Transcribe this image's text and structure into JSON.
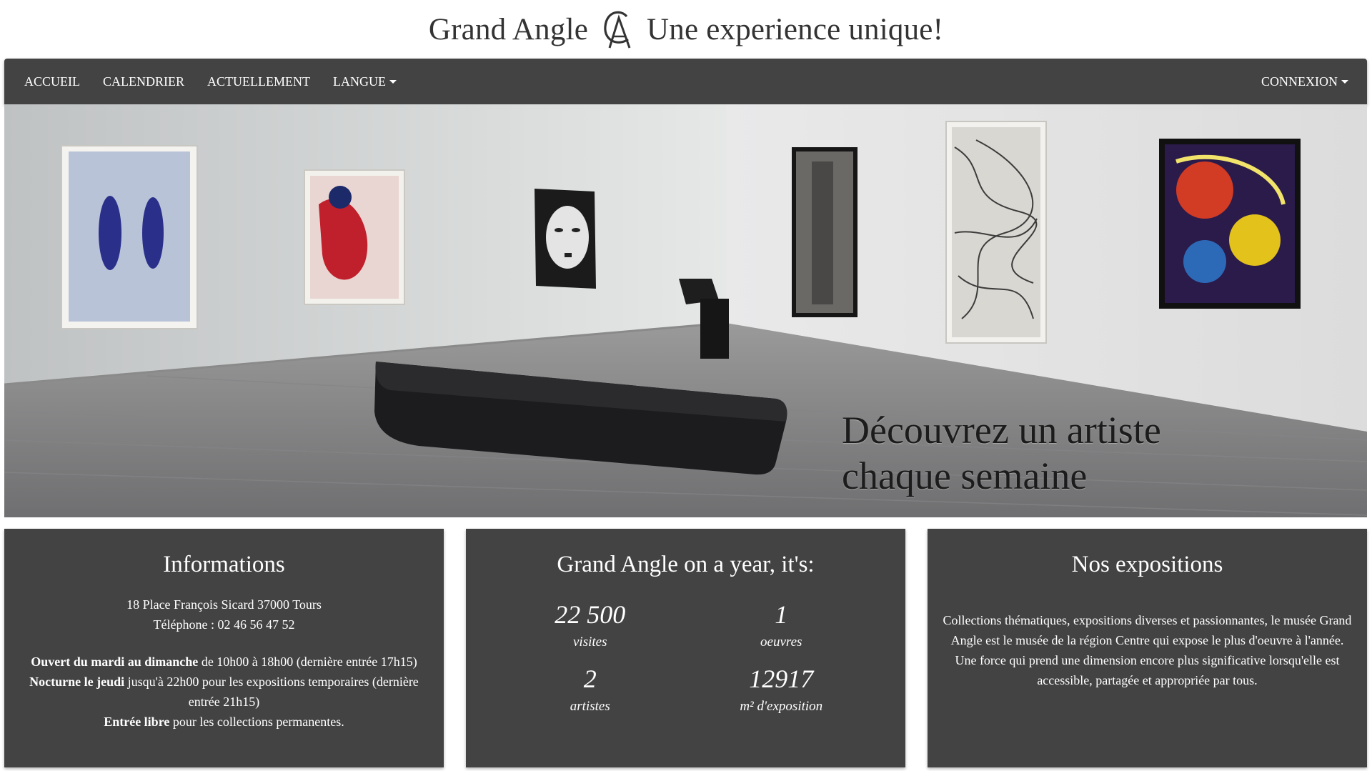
{
  "header": {
    "brand_name": "Grand Angle",
    "tagline": "Une experience unique!",
    "logo_icon": "ga-monogram-icon"
  },
  "nav": {
    "items": [
      {
        "label": "ACCUEIL"
      },
      {
        "label": "CALENDRIER"
      },
      {
        "label": "ACTUELLEMENT"
      },
      {
        "label": "LANGUE",
        "dropdown": true
      }
    ],
    "right": {
      "label": "CONNEXION",
      "dropdown": true
    }
  },
  "hero": {
    "caption_line1": "Découvrez un artiste",
    "caption_line2": "chaque semaine"
  },
  "info": {
    "title": "Informations",
    "address": "18 Place François Sicard 37000 Tours",
    "phone": "Téléphone : 02 46 56 47 52",
    "hours_bold": "Ouvert du mardi au dimanche",
    "hours_rest": " de 10h00 à 18h00 (dernière entrée 17h15)",
    "nocturne_bold": "Nocturne le jeudi",
    "nocturne_rest": " jusqu'à 22h00 pour les expositions temporaires (dernière entrée 21h15)",
    "entry_bold": "Entrée libre",
    "entry_rest": " pour les collections permanentes."
  },
  "stats": {
    "title": "Grand Angle on a year, it's:",
    "items": [
      {
        "value": "22 500",
        "label": "visites"
      },
      {
        "value": "1",
        "label": "oeuvres"
      },
      {
        "value": "2",
        "label": "artistes"
      },
      {
        "value": "12917",
        "label": "m² d'exposition"
      }
    ]
  },
  "expositions": {
    "title": "Nos expositions",
    "description": "Collections thématiques, expositions diverses et passionnantes, le musée Grand Angle est le musée de la région Centre qui expose le plus d'oeuvre à l'année. Une force qui prend une dimension encore plus significative lorsqu'elle est accessible, partagée et appropriée par tous."
  },
  "colors": {
    "panel_bg": "#434343",
    "nav_bg": "#434343",
    "header_text": "#333333"
  }
}
